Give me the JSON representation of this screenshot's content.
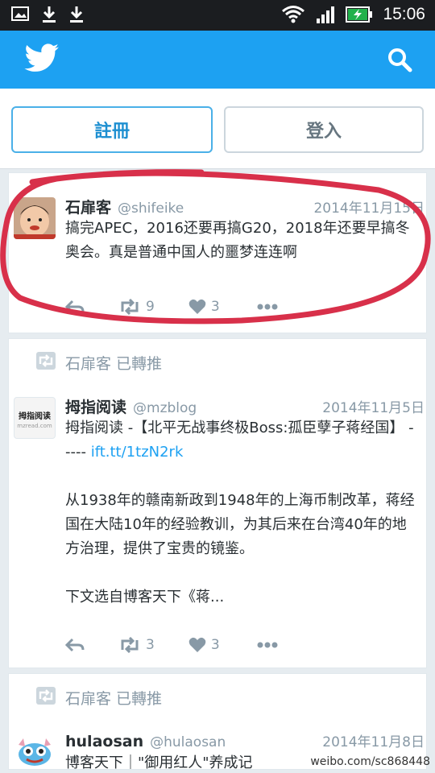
{
  "status_bar": {
    "time": "15:06"
  },
  "auth": {
    "signup_label": "註冊",
    "login_label": "登入"
  },
  "tweets": [
    {
      "name": "石扉客",
      "handle": "@shifeike",
      "date": "2014年11月15日",
      "text": "搞完APEC，2016还要再搞G20，2018年还要早搞冬奥会。真是普通中国人的噩梦连连啊",
      "retweets": "9",
      "likes": "3"
    },
    {
      "retweeted_by": "石扉客 已轉推",
      "name": "拇指阅读",
      "handle": "@mzblog",
      "date": "2014年11月5日",
      "avatar_text": "拇指阅读",
      "avatar_sub": "mzread.com",
      "text_a": "拇指阅读 -【北平无战事终极Boss:孤臣孽子蒋经国】 ----- ",
      "link": "ift.tt/1tzN2rk",
      "text_b": "从1938年的赣南新政到1948年的上海币制改革，蒋经国在大陆10年的经验教训，为其后来在台湾40年的地方治理，提供了宝贵的镜鉴。",
      "text_c": "下文选自博客天下《蒋...",
      "retweets": "3",
      "likes": "3"
    },
    {
      "retweeted_by": "石扉客 已轉推",
      "name": "hulaosan",
      "handle": "@hulaosan",
      "date": "2014年11月8日",
      "text": "博客天下｜\"御用红人\"养成记"
    }
  ],
  "watermark": "weibo.com/sc868448",
  "colors": {
    "brand": "#1da1f2",
    "annotation": "#d8304a"
  }
}
